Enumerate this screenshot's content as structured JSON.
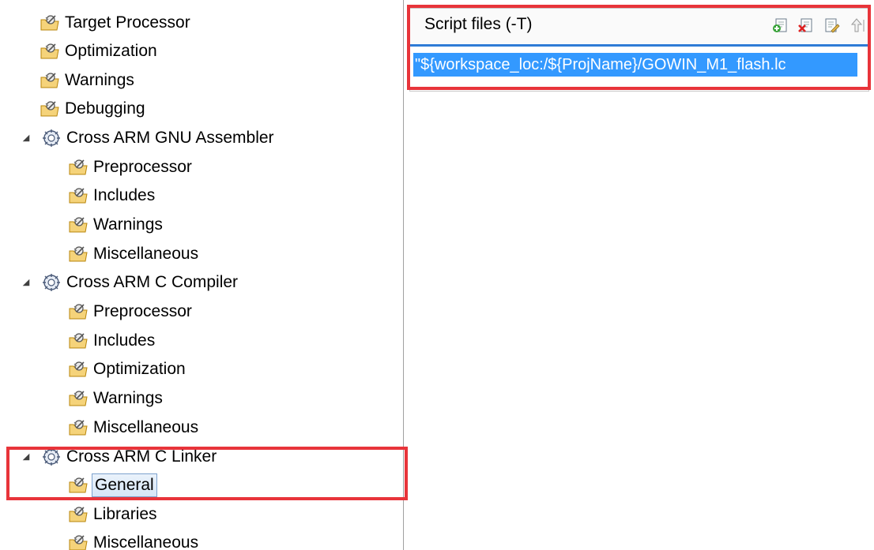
{
  "tree": {
    "items": [
      {
        "label": "Target Processor",
        "level": 1
      },
      {
        "label": "Optimization",
        "level": 1
      },
      {
        "label": "Warnings",
        "level": 1
      },
      {
        "label": "Debugging",
        "level": 1
      },
      {
        "label": "Cross ARM GNU Assembler",
        "level": 0,
        "expanded": true
      },
      {
        "label": "Preprocessor",
        "level": 2
      },
      {
        "label": "Includes",
        "level": 2
      },
      {
        "label": "Warnings",
        "level": 2
      },
      {
        "label": "Miscellaneous",
        "level": 2
      },
      {
        "label": "Cross ARM C Compiler",
        "level": 0,
        "expanded": true
      },
      {
        "label": "Preprocessor",
        "level": 2
      },
      {
        "label": "Includes",
        "level": 2
      },
      {
        "label": "Optimization",
        "level": 2
      },
      {
        "label": "Warnings",
        "level": 2
      },
      {
        "label": "Miscellaneous",
        "level": 2
      },
      {
        "label": "Cross ARM C Linker",
        "level": 0,
        "expanded": true
      },
      {
        "label": "General",
        "level": 2,
        "selected": true
      },
      {
        "label": "Libraries",
        "level": 2
      },
      {
        "label": "Miscellaneous",
        "level": 2
      }
    ]
  },
  "script_panel": {
    "title": "Script files (-T)",
    "toolbar": [
      "add-icon",
      "delete-icon",
      "edit-icon",
      "move-up-icon"
    ],
    "entries": [
      "\"${workspace_loc:/${ProjName}/GOWIN_M1_flash.lc"
    ]
  },
  "colors": {
    "highlight": "#e8343a",
    "selection": "#3399ff"
  }
}
